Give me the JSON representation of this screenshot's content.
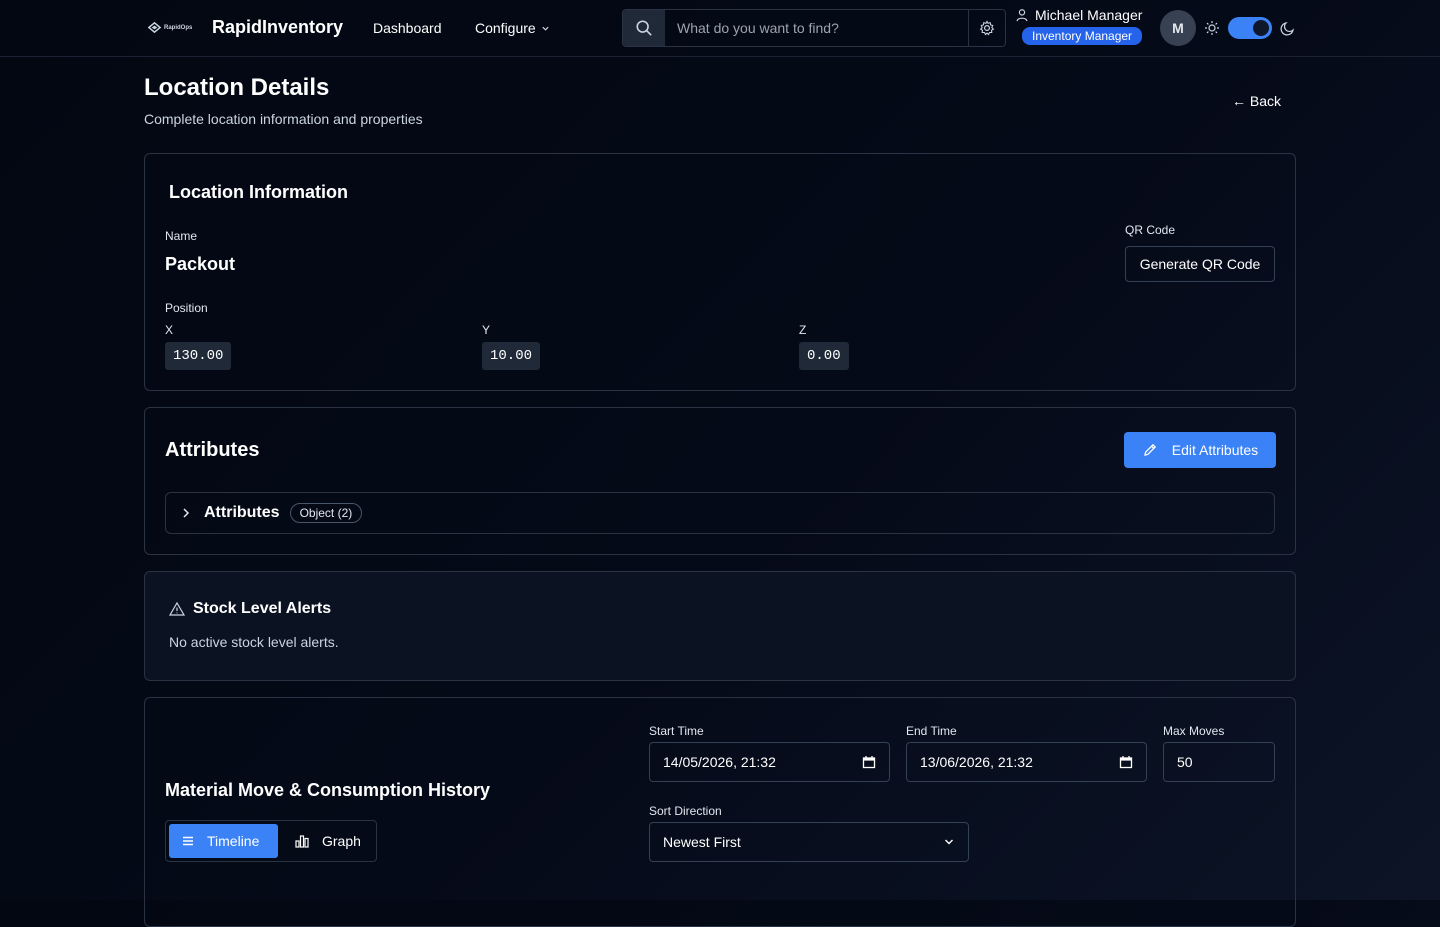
{
  "header": {
    "logo_small": "RapidOps",
    "app_title": "RapidInventory",
    "nav": {
      "dashboard": "Dashboard",
      "configure": "Configure"
    },
    "search_placeholder": "What do you want to find?",
    "user_name": "Michael Manager",
    "user_role": "Inventory Manager",
    "avatar_initial": "M",
    "dark_mode_enabled": true,
    "accent_color": "#3b82f6"
  },
  "page": {
    "title": "Location Details",
    "subtitle": "Complete location information and properties",
    "back_label": "← Back"
  },
  "location_info": {
    "title": "Location Information",
    "name_label": "Name",
    "name_value": "Packout",
    "qr_label": "QR Code",
    "qr_button": "Generate QR Code",
    "position_label": "Position",
    "x_label": "X",
    "x_value": "130.00",
    "y_label": "Y",
    "y_value": "10.00",
    "z_label": "Z",
    "z_value": "0.00"
  },
  "attributes": {
    "title": "Attributes",
    "edit_button": "Edit Attributes",
    "row_label": "Attributes",
    "row_badge": "Object (2)"
  },
  "alerts": {
    "title": "Stock Level Alerts",
    "empty_text": "No active stock level alerts."
  },
  "history": {
    "title": "Material Move & Consumption History",
    "view_timeline": "Timeline",
    "view_graph": "Graph",
    "start_label": "Start Time",
    "start_value": "14/05/2026, 21:32",
    "end_label": "End Time",
    "end_value": "13/06/2026, 21:32",
    "max_label": "Max Moves",
    "max_value": "50",
    "sort_label": "Sort Direction",
    "sort_value": "Newest First"
  }
}
